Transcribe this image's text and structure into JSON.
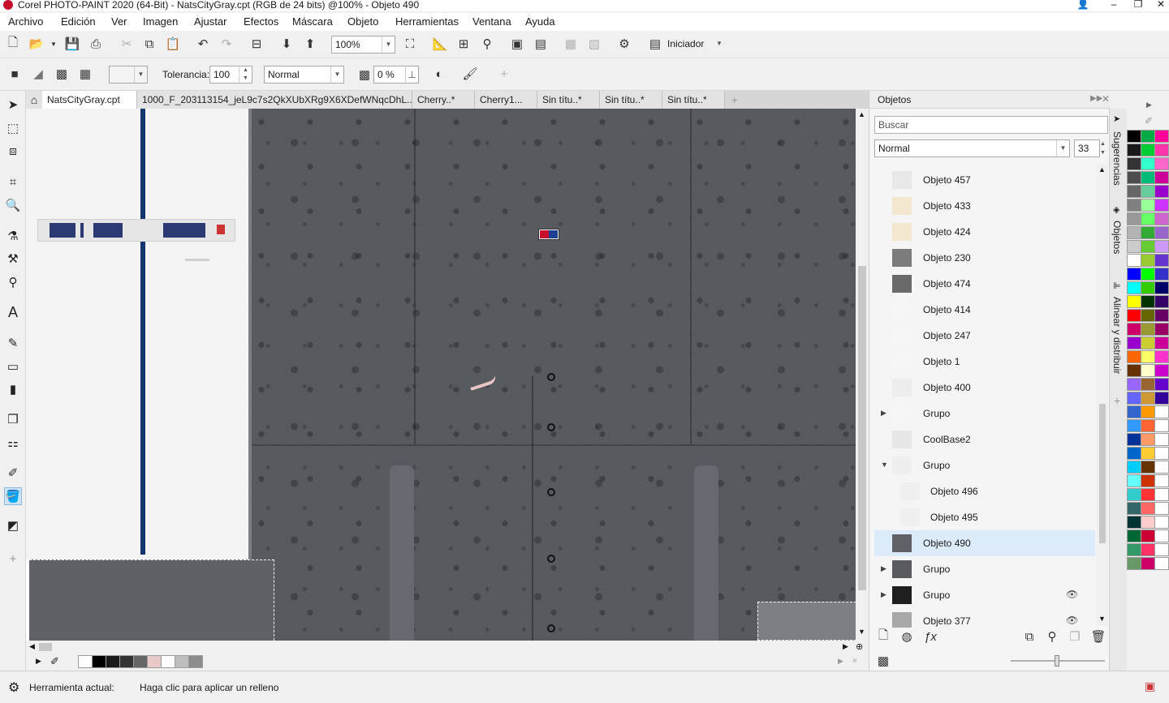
{
  "window": {
    "title": "Corel PHOTO-PAINT 2020 (64-Bit) - NatsCityGray.cpt (RGB de 24 bits) @100% - Objeto 490"
  },
  "menu": [
    "Archivo",
    "Edición",
    "Ver",
    "Imagen",
    "Ajustar",
    "Efectos",
    "Máscara",
    "Objeto",
    "Herramientas",
    "Ventana",
    "Ayuda"
  ],
  "toolbar": {
    "zoom_value": "100%",
    "launcher_label": "Iniciador"
  },
  "property_bar": {
    "tolerance_label": "Tolerancia:",
    "tolerance_value": "100",
    "merge_mode": "Normal",
    "transparency_value": "0 %"
  },
  "document_tabs": [
    {
      "label": "NatsCityGray.cpt",
      "active": true
    },
    {
      "label": "1000_F_203113154_jeL9c7s2QkXUbXRg9X6XDefWNqcDhL..*",
      "active": false
    },
    {
      "label": "Cherry..*",
      "active": false
    },
    {
      "label": "Cherry1...",
      "active": false
    },
    {
      "label": "Sin títu..*",
      "active": false
    },
    {
      "label": "Sin títu..*",
      "active": false
    },
    {
      "label": "Sin títu..*",
      "active": false
    }
  ],
  "objects_docker": {
    "title": "Objetos",
    "search_placeholder": "Buscar",
    "merge_mode": "Normal",
    "opacity_value": "33",
    "items": [
      {
        "name": "Objeto 457",
        "indent": 0,
        "expander": "",
        "thumb": "#e8e8e8",
        "eye": false
      },
      {
        "name": "Objeto 433",
        "indent": 0,
        "expander": "",
        "thumb": "#f3e7cf",
        "eye": false
      },
      {
        "name": "Objeto 424",
        "indent": 0,
        "expander": "",
        "thumb": "#f3e7cf",
        "eye": false
      },
      {
        "name": "Objeto 230",
        "indent": 0,
        "expander": "",
        "thumb": "#7b7b7b",
        "eye": false
      },
      {
        "name": "Objeto 474",
        "indent": 0,
        "expander": "",
        "thumb": "#6a6a6a",
        "eye": false
      },
      {
        "name": "Objeto 414",
        "indent": 0,
        "expander": "",
        "thumb": "#f6f6f6",
        "eye": false
      },
      {
        "name": "Objeto 247",
        "indent": 0,
        "expander": "",
        "thumb": "#f6f6f6",
        "eye": false
      },
      {
        "name": "Objeto 1",
        "indent": 0,
        "expander": "",
        "thumb": "#f6f6f6",
        "eye": false
      },
      {
        "name": "Objeto 400",
        "indent": 0,
        "expander": "",
        "thumb": "#ededed",
        "eye": false
      },
      {
        "name": "Grupo",
        "indent": 0,
        "expander": "▶",
        "thumb": "#f6f6f6",
        "eye": false
      },
      {
        "name": "CoolBase2",
        "indent": 0,
        "expander": "",
        "thumb": "#e6e6e6",
        "eye": false
      },
      {
        "name": "Grupo",
        "indent": 0,
        "expander": "▼",
        "thumb": "#eeeeee",
        "eye": false
      },
      {
        "name": "Objeto 496",
        "indent": 1,
        "expander": "",
        "thumb": "#efefef",
        "eye": false
      },
      {
        "name": "Objeto 495",
        "indent": 1,
        "expander": "",
        "thumb": "#efefef",
        "eye": false
      },
      {
        "name": "Objeto 490",
        "indent": 0,
        "expander": "",
        "thumb": "#5f6166",
        "eye": false,
        "selected": true
      },
      {
        "name": "Grupo",
        "indent": 0,
        "expander": "▶",
        "thumb": "#595b60",
        "eye": false
      },
      {
        "name": "Grupo",
        "indent": 0,
        "expander": "▶",
        "thumb": "#1f1f1f",
        "eye": true
      },
      {
        "name": "Objeto 377",
        "indent": 0,
        "expander": "",
        "thumb": "#a8a8a8",
        "eye": true
      }
    ]
  },
  "docker_tabs": [
    "Sugerencias",
    "Objetos",
    "Alinear y distribuir"
  ],
  "color_palette": [
    [
      "#000000",
      "#00aa44",
      "#ff0099"
    ],
    [
      "#1a1a1a",
      "#00cc33",
      "#ff33aa"
    ],
    [
      "#333333",
      "#33ffcc",
      "#ff66cc"
    ],
    [
      "#4d4d4d",
      "#00bb77",
      "#cc0099"
    ],
    [
      "#666666",
      "#66cc99",
      "#9900cc"
    ],
    [
      "#808080",
      "#99ff99",
      "#cc33ff"
    ],
    [
      "#999999",
      "#66ff66",
      "#cc66cc"
    ],
    [
      "#b3b3b3",
      "#33aa33",
      "#9966cc"
    ],
    [
      "#cccccc",
      "#66cc33",
      "#cc99ff"
    ],
    [
      "#ffffff",
      "#99cc33",
      "#6633cc"
    ],
    [
      "#0000ff",
      "#00ff00",
      "#3333cc"
    ],
    [
      "#00ffff",
      "#33cc00",
      "#000066"
    ],
    [
      "#ffff00",
      "#003300",
      "#330066"
    ],
    [
      "#ff0000",
      "#666600",
      "#660066"
    ],
    [
      "#cc0066",
      "#999933",
      "#990066"
    ],
    [
      "#9900cc",
      "#cccc33",
      "#cc0099"
    ],
    [
      "#ff6600",
      "#ffff66",
      "#ff33cc"
    ],
    [
      "#663300",
      "#ffffcc",
      "#cc00cc"
    ],
    [
      "#9966ff",
      "#996633",
      "#6600cc"
    ],
    [
      "#6666ff",
      "#cc9933",
      "#330099"
    ],
    [
      "#3366cc",
      "#ff9900",
      "#ffffff"
    ],
    [
      "#3399ff",
      "#ff6633",
      "#ffffff"
    ],
    [
      "#003399",
      "#ff9966",
      "#ffffff"
    ],
    [
      "#0066cc",
      "#ffcc33",
      "#ffffff"
    ],
    [
      "#00ccff",
      "#663300",
      "#ffffff"
    ],
    [
      "#66ffff",
      "#cc3300",
      "#ffffff"
    ],
    [
      "#33cccc",
      "#ff3333",
      "#ffffff"
    ],
    [
      "#336666",
      "#ff6666",
      "#ffffff"
    ],
    [
      "#003333",
      "#ffcccc",
      "#ffffff"
    ],
    [
      "#006633",
      "#cc0033",
      "#ffffff"
    ],
    [
      "#339966",
      "#ff3366",
      "#ffffff"
    ],
    [
      "#669966",
      "#cc0066",
      "#ffffff"
    ]
  ],
  "document_palette": [
    "#ffffff",
    "#000000",
    "#1a1a1a",
    "#333333",
    "#666666",
    "#e8c8c8",
    "#ffffff",
    "#bdbdbd",
    "#8c8c8c"
  ],
  "status": {
    "label": "Herramienta actual:",
    "message": "Haga clic para aplicar un relleno"
  }
}
